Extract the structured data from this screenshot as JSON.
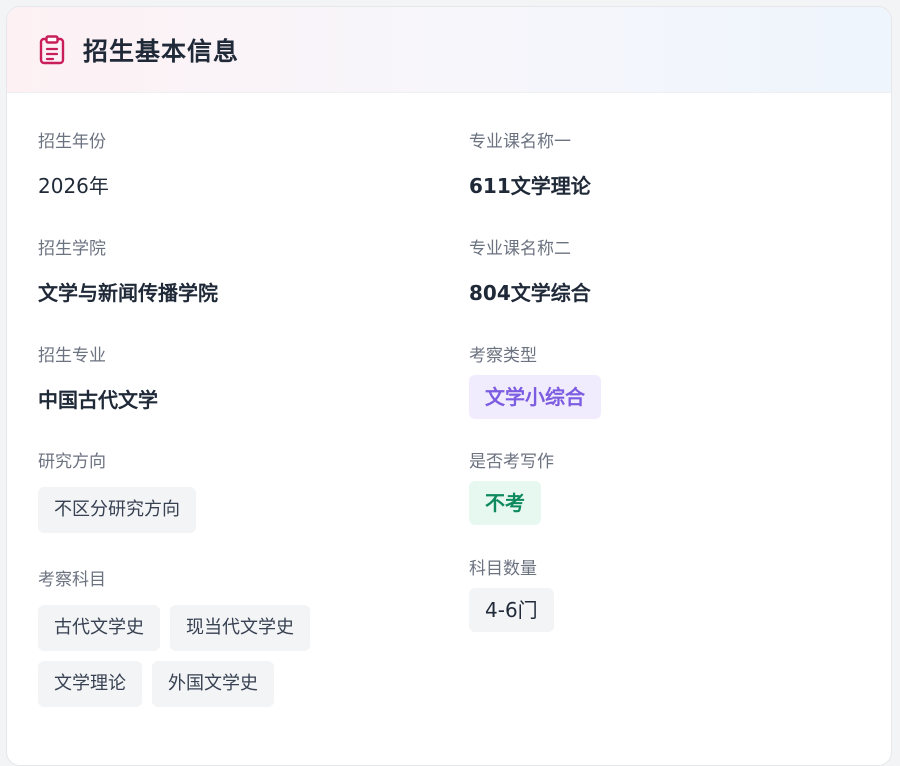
{
  "card": {
    "title": "招生基本信息",
    "icon": "clipboard-icon",
    "icon_color": "#c81e5a"
  },
  "left": {
    "year": {
      "label": "招生年份",
      "value": "2026年"
    },
    "college": {
      "label": "招生学院",
      "value": "文学与新闻传播学院"
    },
    "major": {
      "label": "招生专业",
      "value": "中国古代文学"
    },
    "direction": {
      "label": "研究方向",
      "value": "不区分研究方向"
    },
    "subjects": {
      "label": "考察科目",
      "items": [
        "古代文学史",
        "现当代文学史",
        "文学理论",
        "外国文学史"
      ]
    }
  },
  "right": {
    "course1": {
      "label": "专业课名称一",
      "value": "611文学理论"
    },
    "course2": {
      "label": "专业课名称二",
      "value": "804文学综合"
    },
    "exam_type": {
      "label": "考察类型",
      "value": "文学小综合"
    },
    "writing": {
      "label": "是否考写作",
      "value": "不考"
    },
    "subject_count": {
      "label": "科目数量",
      "value": "4-6门"
    }
  },
  "colors": {
    "purple_tag_bg": "#f1ecfd",
    "purple_tag_text": "#7c5ce0",
    "green_tag_bg": "#e7f8f0",
    "green_tag_text": "#0f8a5f"
  }
}
